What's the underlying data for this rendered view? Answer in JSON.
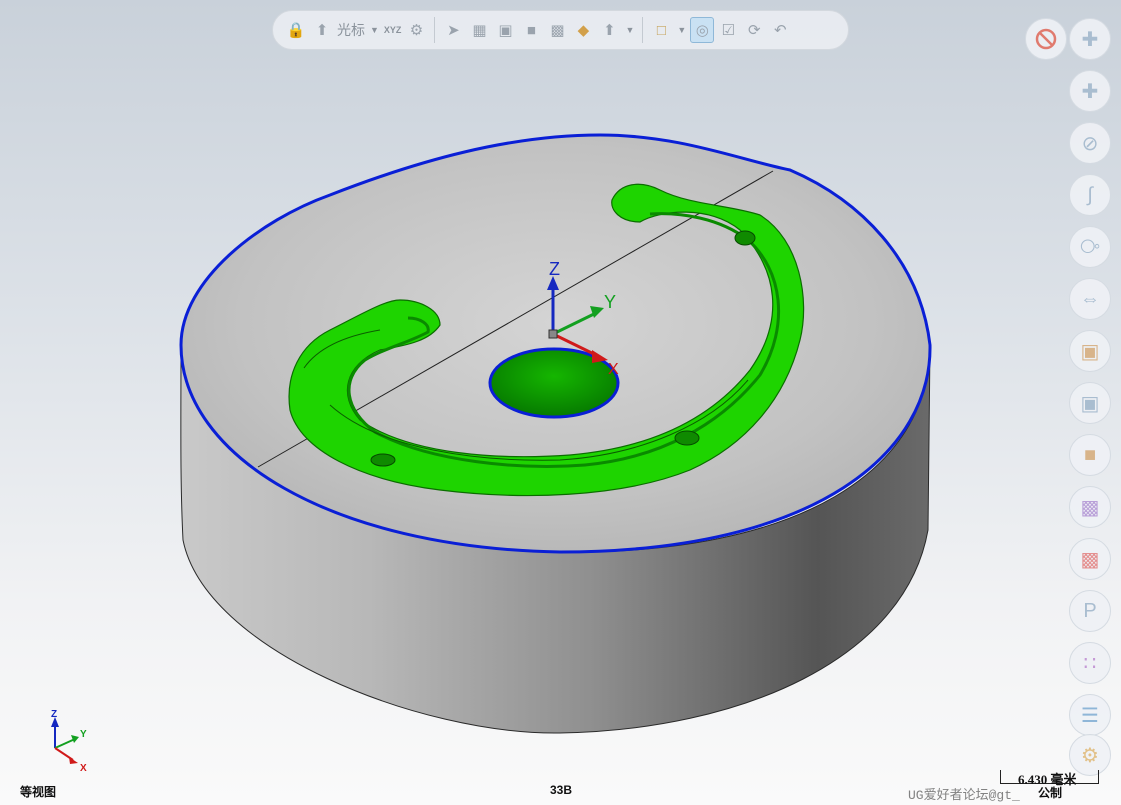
{
  "toolbar": {
    "cursor_label": "光标",
    "xyz_label": "XYZ",
    "items": [
      "lock-icon",
      "select-cursor-icon",
      "xyz-point-icon",
      "point-settings-icon",
      "arrow-select-icon",
      "feature-select-icon",
      "face-select-icon",
      "body-select-icon",
      "component-select-icon",
      "assembly-select-icon",
      "cursor-filter-icon",
      "box-select-icon",
      "highlight-toggle-icon",
      "check-select-icon",
      "rotate-select-icon",
      "undo-select-icon"
    ]
  },
  "right_toolbar": {
    "buttons": [
      "plus-snap-icon",
      "point-on-curve-icon",
      "circle-center-icon",
      "curve-icon",
      "grid-cube-icon",
      "dimension-icon",
      "slice-icon",
      "shaded-cube-icon",
      "solid-cube-icon",
      "color-cube-icon",
      "red-cube-icon",
      "text-p-icon",
      "palette-icon",
      "layers-icon",
      "gear-icon"
    ]
  },
  "viewport": {
    "axis_labels": {
      "x": "X",
      "y": "Y",
      "z": "Z"
    },
    "colors": {
      "edge_blue": "#0a1fd6",
      "face_green": "#1fd400",
      "face_green_dark": "#0aa000",
      "body_top": "#c9c9c9",
      "body_side_dark": "#4d4d4d"
    }
  },
  "status": {
    "view_name": "等视图",
    "count": "33B",
    "scale": "6.430 毫米",
    "unit_system": "公制",
    "watermark": "UG爱好者论坛@gt_"
  },
  "triad": {
    "x": "X",
    "y": "Y",
    "z": "Z"
  }
}
